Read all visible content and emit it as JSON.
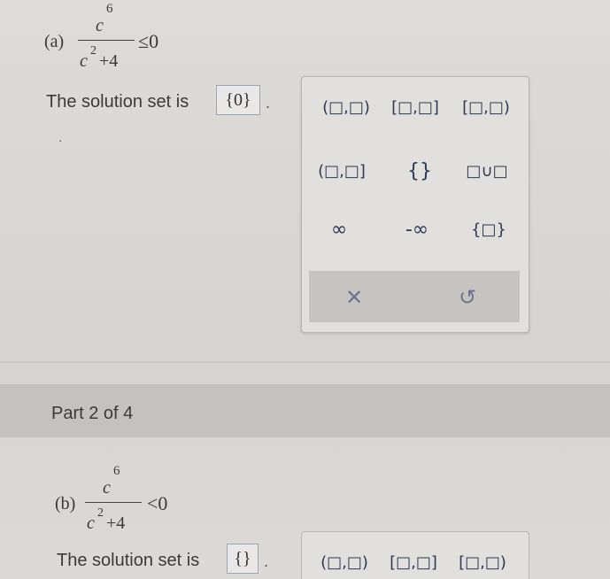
{
  "part_a": {
    "label": "(a)",
    "numerator": "c",
    "num_exp": "6",
    "den_base": "c",
    "den_exp": "2",
    "den_rest": "+4",
    "relation": "≤0",
    "solution_text": "The solution set is",
    "answer": "{0}",
    "period": "."
  },
  "part_header": {
    "title": "Part 2 of 4"
  },
  "part_b": {
    "label": "(b)",
    "numerator": "c",
    "num_exp": "6",
    "den_base": "c",
    "den_exp": "2",
    "den_rest": "+4",
    "relation": "<0",
    "solution_text": "The solution set is",
    "answer": "{}",
    "period": "."
  },
  "keypad": {
    "open_interval": "(□,□)",
    "closed_interval": "[□,□]",
    "half_open_left_closed": "[□,□)",
    "half_open_right_closed": "(□,□]",
    "empty_set": "{}",
    "union": "□∪□",
    "infinity": "∞",
    "neg_infinity": "-∞",
    "set_braces": "{□}",
    "clear_icon": "x-icon",
    "undo_icon": "undo-icon"
  },
  "keypad_b": {
    "open_interval": "(□,□)",
    "closed_interval": "[□,□]",
    "half_open_left_closed": "[□,□)"
  }
}
